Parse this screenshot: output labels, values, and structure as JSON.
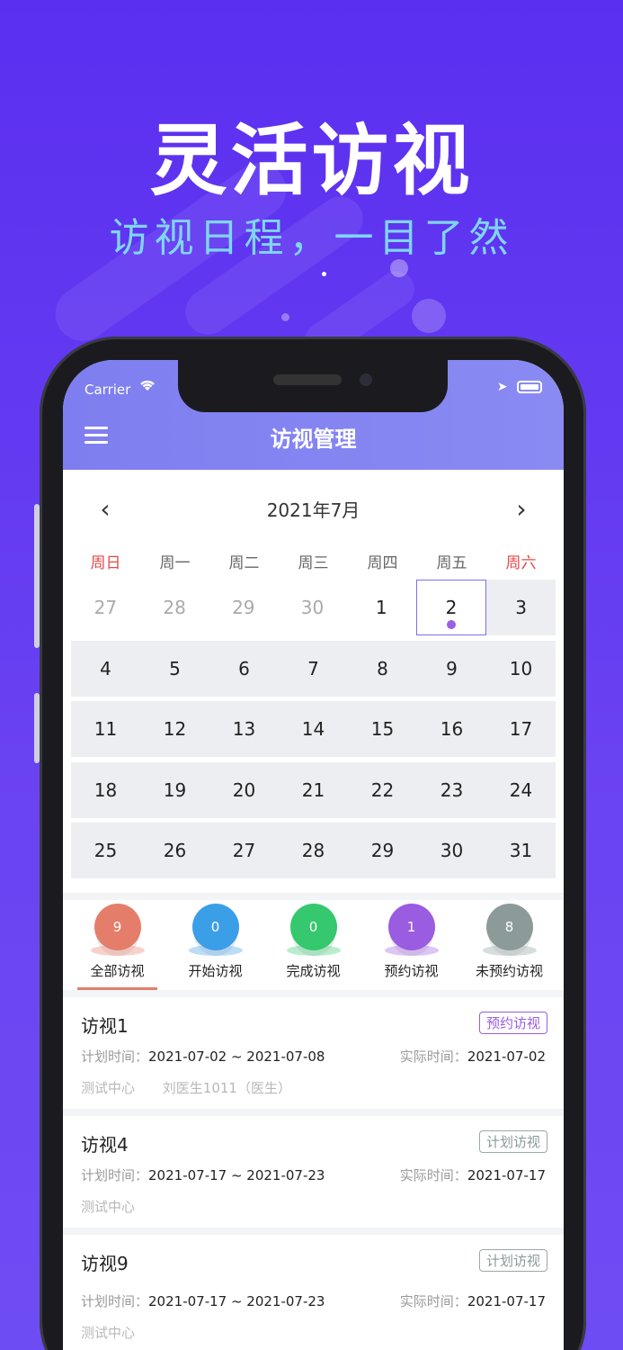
{
  "hero": {
    "title": "灵活访视",
    "subtitle": "访视日程，一目了然"
  },
  "status_bar": {
    "carrier": "Carrier"
  },
  "app_bar": {
    "title": "访视管理"
  },
  "calendar": {
    "month_label": "2021年7月",
    "weekdays": [
      "周日",
      "周一",
      "周二",
      "周三",
      "周四",
      "周五",
      "周六"
    ],
    "weeks": [
      [
        "27",
        "28",
        "29",
        "30",
        "1",
        "2",
        "3"
      ],
      [
        "4",
        "5",
        "6",
        "7",
        "8",
        "9",
        "10"
      ],
      [
        "11",
        "12",
        "13",
        "14",
        "15",
        "16",
        "17"
      ],
      [
        "18",
        "19",
        "20",
        "21",
        "22",
        "23",
        "24"
      ],
      [
        "25",
        "26",
        "27",
        "28",
        "29",
        "30",
        "31"
      ]
    ],
    "selected_day": "2"
  },
  "filters": [
    {
      "label": "全部访视",
      "count": "9",
      "color": "#e47e6b",
      "active": true
    },
    {
      "label": "开始访视",
      "count": "0",
      "color": "#3b9fe8",
      "active": false
    },
    {
      "label": "完成访视",
      "count": "0",
      "color": "#35c86e",
      "active": false
    },
    {
      "label": "预约访视",
      "count": "1",
      "color": "#9a5ce0",
      "active": false
    },
    {
      "label": "未预约访视",
      "count": "8",
      "color": "#8c9a9a",
      "active": false
    }
  ],
  "visits": [
    {
      "name": "访视1",
      "tag": "预约访视",
      "tag_color": "#9a5ce0",
      "plan_label": "计划时间：",
      "plan_value": "2021-07-02 ~ 2021-07-08",
      "actual_label": "实际时间：",
      "actual_value": "2021-07-02",
      "center": "测试中心",
      "doctor": "刘医生1011（医生）"
    },
    {
      "name": "访视4",
      "tag": "计划访视",
      "tag_color": "#8a9a98",
      "plan_label": "计划时间：",
      "plan_value": "2021-07-17 ~ 2021-07-23",
      "actual_label": "实际时间：",
      "actual_value": "2021-07-17",
      "center": "测试中心"
    },
    {
      "name": "访视9",
      "tag": "计划访视",
      "tag_color": "#8a9a98",
      "plan_label": "计划时间：",
      "plan_value": "2021-07-17 ~ 2021-07-23",
      "actual_label": "实际时间：",
      "actual_value": "2021-07-17",
      "center": "测试中心"
    }
  ]
}
